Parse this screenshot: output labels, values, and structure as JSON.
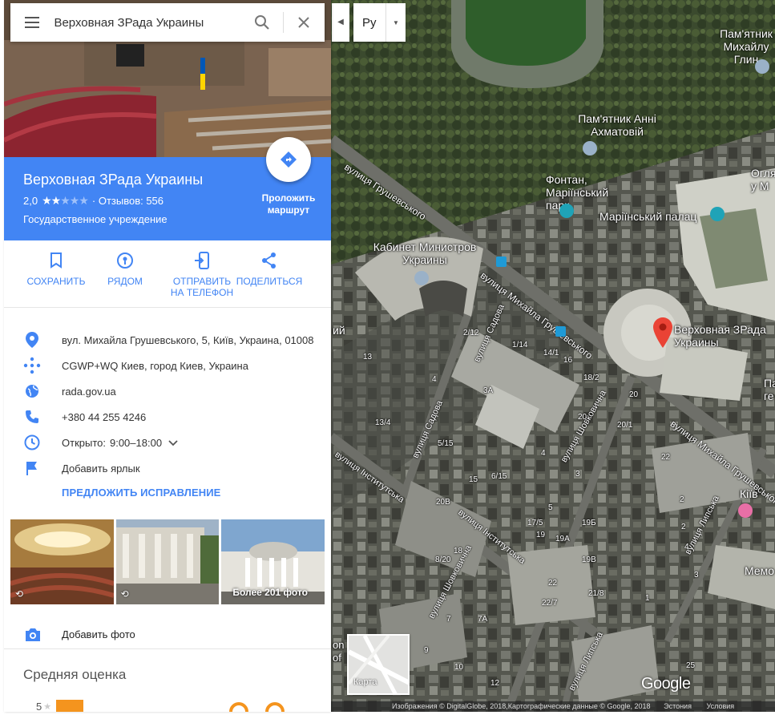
{
  "search": {
    "value": "Верховная ЗРада Украины"
  },
  "language": {
    "value": "Ру"
  },
  "place": {
    "title": "Верховная ЗРада Украины",
    "rating_value": "2,0",
    "rating_stars": 2,
    "rating_max": 5,
    "reviews_text": "· Отзывов: 556",
    "category": "Государственное учреждение",
    "route_label": "Проложить маршрут"
  },
  "actions": [
    {
      "icon": "bookmark-icon",
      "label": "СОХРАНИТЬ"
    },
    {
      "icon": "nearby-icon",
      "label": "РЯДОМ"
    },
    {
      "icon": "send-to-phone-icon",
      "label": "ОТПРАВИТЬ НА ТЕЛЕФОН"
    },
    {
      "icon": "share-icon",
      "label": "ПОДЕЛИТЬСЯ"
    }
  ],
  "info": {
    "address": "вул. Михайла Грушевського, 5, Київ, Украина, 01008",
    "plus_code": "CGWP+WQ Киев, город Киев, Украина",
    "website": "rada.gov.ua",
    "phone": "+380 44 255 4246",
    "hours_prefix": "Открыто:",
    "hours": "9:00–18:00",
    "label": "Добавить ярлык",
    "suggest_edit": "ПРЕДЛОЖИТЬ ИСПРАВЛЕНИЕ"
  },
  "photos": {
    "more_label": "Более 201 фото"
  },
  "add_photo": "Добавить фото",
  "reviews": {
    "title": "Средняя оценка",
    "row_5": "5"
  },
  "map": {
    "marker_label": "Верховная ЗРада Украины",
    "poi": [
      {
        "name": "Пам'ятник Михайлу Глин"
      },
      {
        "name": "Пам'ятник Анні Ахматовій"
      },
      {
        "name": "Фонтан, Маріїнський парк"
      },
      {
        "name": "Маріїнський палац"
      },
      {
        "name": "Кабинет Министров Украины"
      },
      {
        "name": "Огля у М"
      },
      {
        "name": "Кіїв"
      },
      {
        "name": "Мемо"
      },
      {
        "name": "Па ге"
      },
      {
        "name": "ий"
      }
    ],
    "streets": [
      "вулиця Михайла Грушевського",
      "вулиця Грушевського",
      "вулиця Садова",
      "вулиця Шовковична",
      "вулиця Інститутська",
      "вулиця Липська"
    ],
    "house_numbers": [
      "13",
      "13/4",
      "4",
      "2/12",
      "1/14",
      "14/1",
      "16",
      "18/2",
      "20",
      "20/1",
      "22",
      "3А",
      "5/15",
      "6/15",
      "15",
      "3",
      "2",
      "4",
      "20В",
      "20",
      "17/5",
      "19",
      "19А",
      "19Б",
      "19В",
      "8/20",
      "18",
      "7",
      "7А",
      "22",
      "22/7",
      "21/8",
      "9",
      "10",
      "12",
      "5",
      "2",
      "4",
      "1",
      "3",
      "25"
    ],
    "map_type_label": "Карта",
    "google_logo": "Google",
    "attribution": "Изображения © DigitalGlobe, 2018,Картографические данные © Google, 2018",
    "terms": "Условия",
    "more_left": "Эстония",
    "left_edge_label": "on of"
  },
  "colors": {
    "accent": "#4285f4",
    "marker": "#ea4335",
    "star": "#f4941e"
  }
}
